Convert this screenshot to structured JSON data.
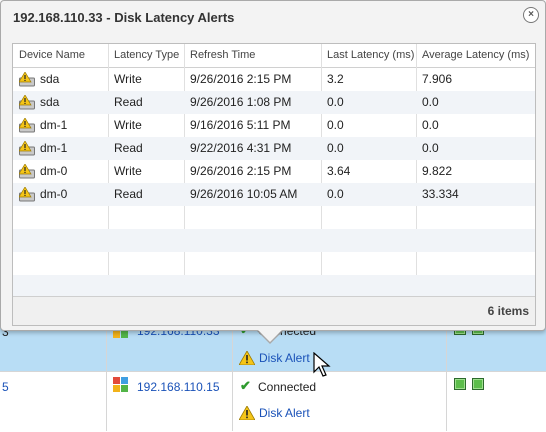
{
  "popup": {
    "title": "192.168.110.33 - Disk Latency Alerts",
    "columns": [
      "Device Name",
      "Latency Type",
      "Refresh Time",
      "Last Latency (ms)",
      "Average Latency (ms)"
    ],
    "rows": [
      {
        "device": "sda",
        "type": "Write",
        "time": "9/26/2016 2:15 PM",
        "last": "3.2",
        "avg": "7.906"
      },
      {
        "device": "sda",
        "type": "Read",
        "time": "9/26/2016 1:08 PM",
        "last": "0.0",
        "avg": "0.0"
      },
      {
        "device": "dm-1",
        "type": "Write",
        "time": "9/16/2016 5:11 PM",
        "last": "0.0",
        "avg": "0.0"
      },
      {
        "device": "dm-1",
        "type": "Read",
        "time": "9/22/2016 4:31 PM",
        "last": "0.0",
        "avg": "0.0"
      },
      {
        "device": "dm-0",
        "type": "Write",
        "time": "9/26/2016 2:15 PM",
        "last": "3.64",
        "avg": "9.822"
      },
      {
        "device": "dm-0",
        "type": "Read",
        "time": "9/26/2016 10:05 AM",
        "last": "0.0",
        "avg": "33.334"
      }
    ],
    "items_count": "6 items"
  },
  "background": {
    "row1": {
      "edge_text": "3",
      "ip": "192.168.110.33",
      "status": "Connected",
      "alert": "Disk Alert"
    },
    "row2": {
      "edge_text": "5",
      "ip": "192.168.110.15",
      "status": "Connected",
      "alert": "Disk Alert"
    }
  }
}
